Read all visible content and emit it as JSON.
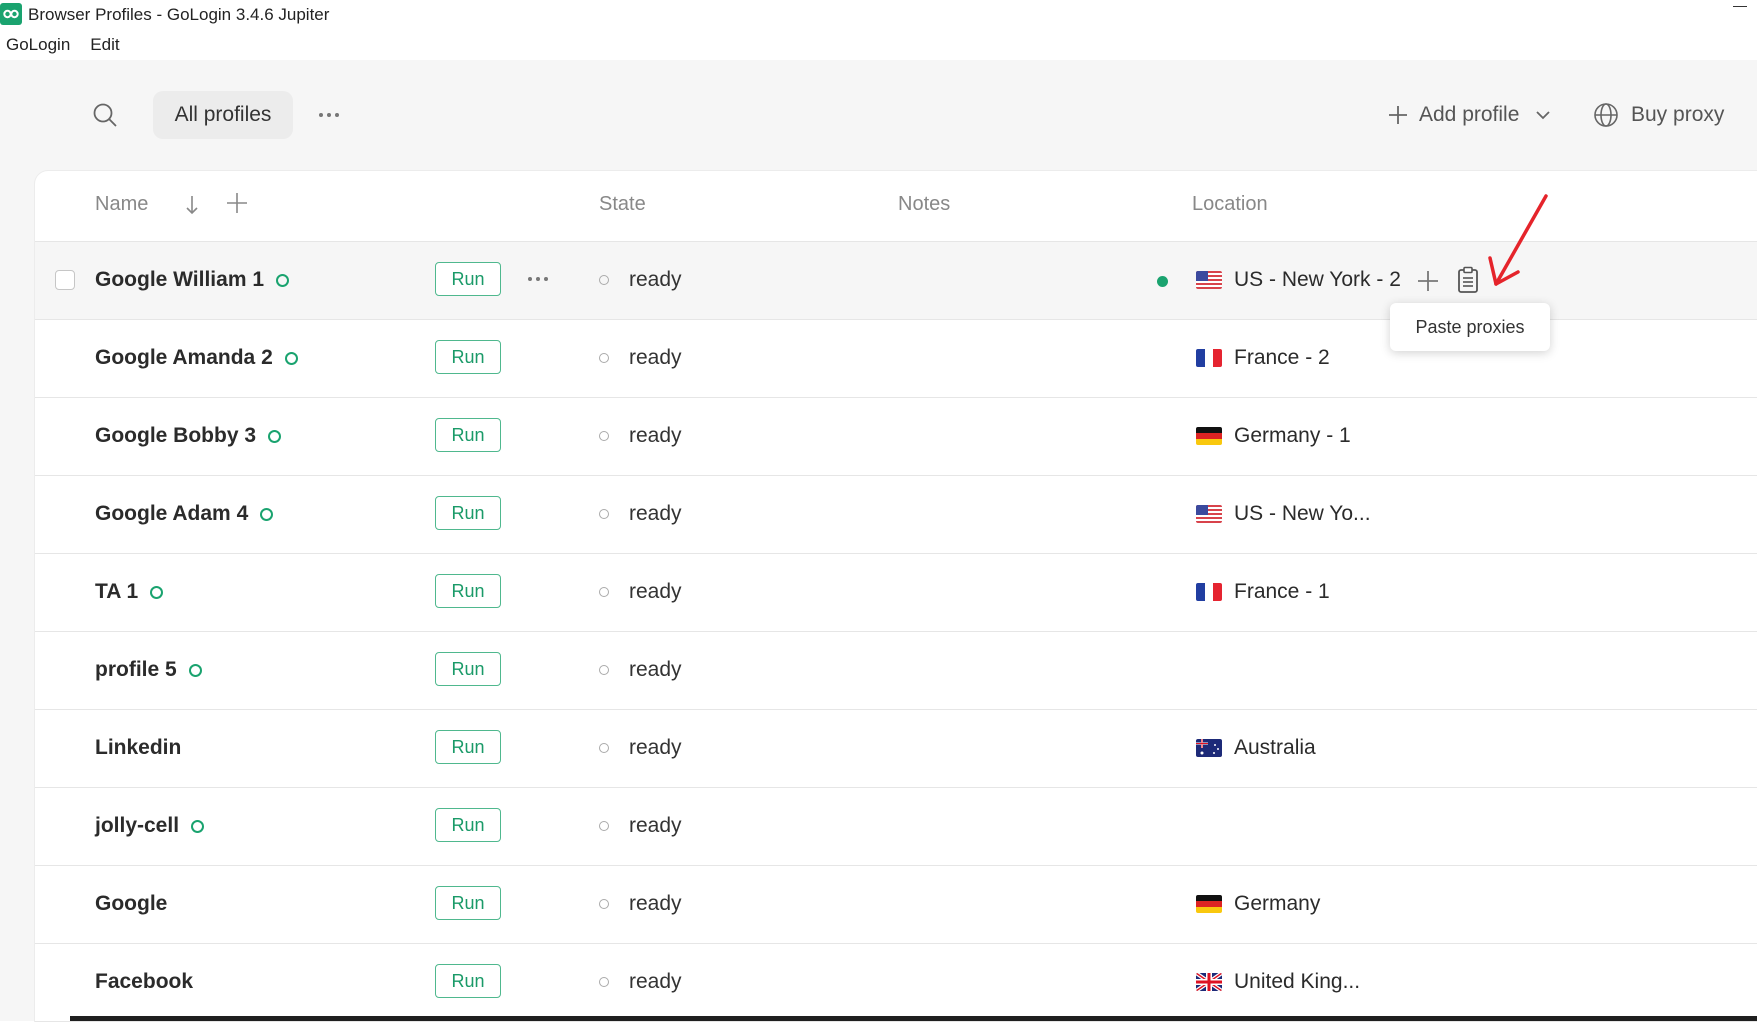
{
  "window": {
    "title": "Browser Profiles - GoLogin 3.4.6 Jupiter",
    "app_icon": "gologin-logo-icon"
  },
  "menu": [
    "GoLogin",
    "Edit"
  ],
  "toolbar": {
    "search_icon": "search-icon",
    "tab_label": "All profiles",
    "more_icon": "more-horizontal-icon",
    "add_profile_label": "Add profile",
    "buy_proxy_label": "Buy proxy"
  },
  "table": {
    "columns": {
      "name": "Name",
      "state": "State",
      "notes": "Notes",
      "location": "Location"
    },
    "run_label": "Run",
    "rows": [
      {
        "name": "Google William 1",
        "online": true,
        "state": "ready",
        "location": "US - New York - 2",
        "flag": "us",
        "proxy_active": true,
        "hovered": true
      },
      {
        "name": "Google Amanda 2",
        "online": true,
        "state": "ready",
        "location": "France - 2",
        "flag": "fr"
      },
      {
        "name": "Google Bobby 3",
        "online": true,
        "state": "ready",
        "location": "Germany - 1",
        "flag": "de"
      },
      {
        "name": "Google Adam 4",
        "online": true,
        "state": "ready",
        "location": "US - New Yo...",
        "flag": "us"
      },
      {
        "name": "TA 1",
        "online": true,
        "state": "ready",
        "location": "France - 1",
        "flag": "fr"
      },
      {
        "name": "profile 5",
        "online": true,
        "state": "ready",
        "location": "",
        "flag": ""
      },
      {
        "name": "Linkedin",
        "online": false,
        "state": "ready",
        "location": "Australia",
        "flag": "au"
      },
      {
        "name": "jolly-cell",
        "online": true,
        "state": "ready",
        "location": "",
        "flag": ""
      },
      {
        "name": "Google",
        "online": false,
        "state": "ready",
        "location": "Germany",
        "flag": "de"
      },
      {
        "name": "Facebook",
        "online": false,
        "state": "ready",
        "location": "United King...",
        "flag": "gb"
      }
    ]
  },
  "tooltip": "Paste proxies",
  "colors": {
    "accent_green": "#1aa36f",
    "annotation_red": "#e5242b"
  }
}
